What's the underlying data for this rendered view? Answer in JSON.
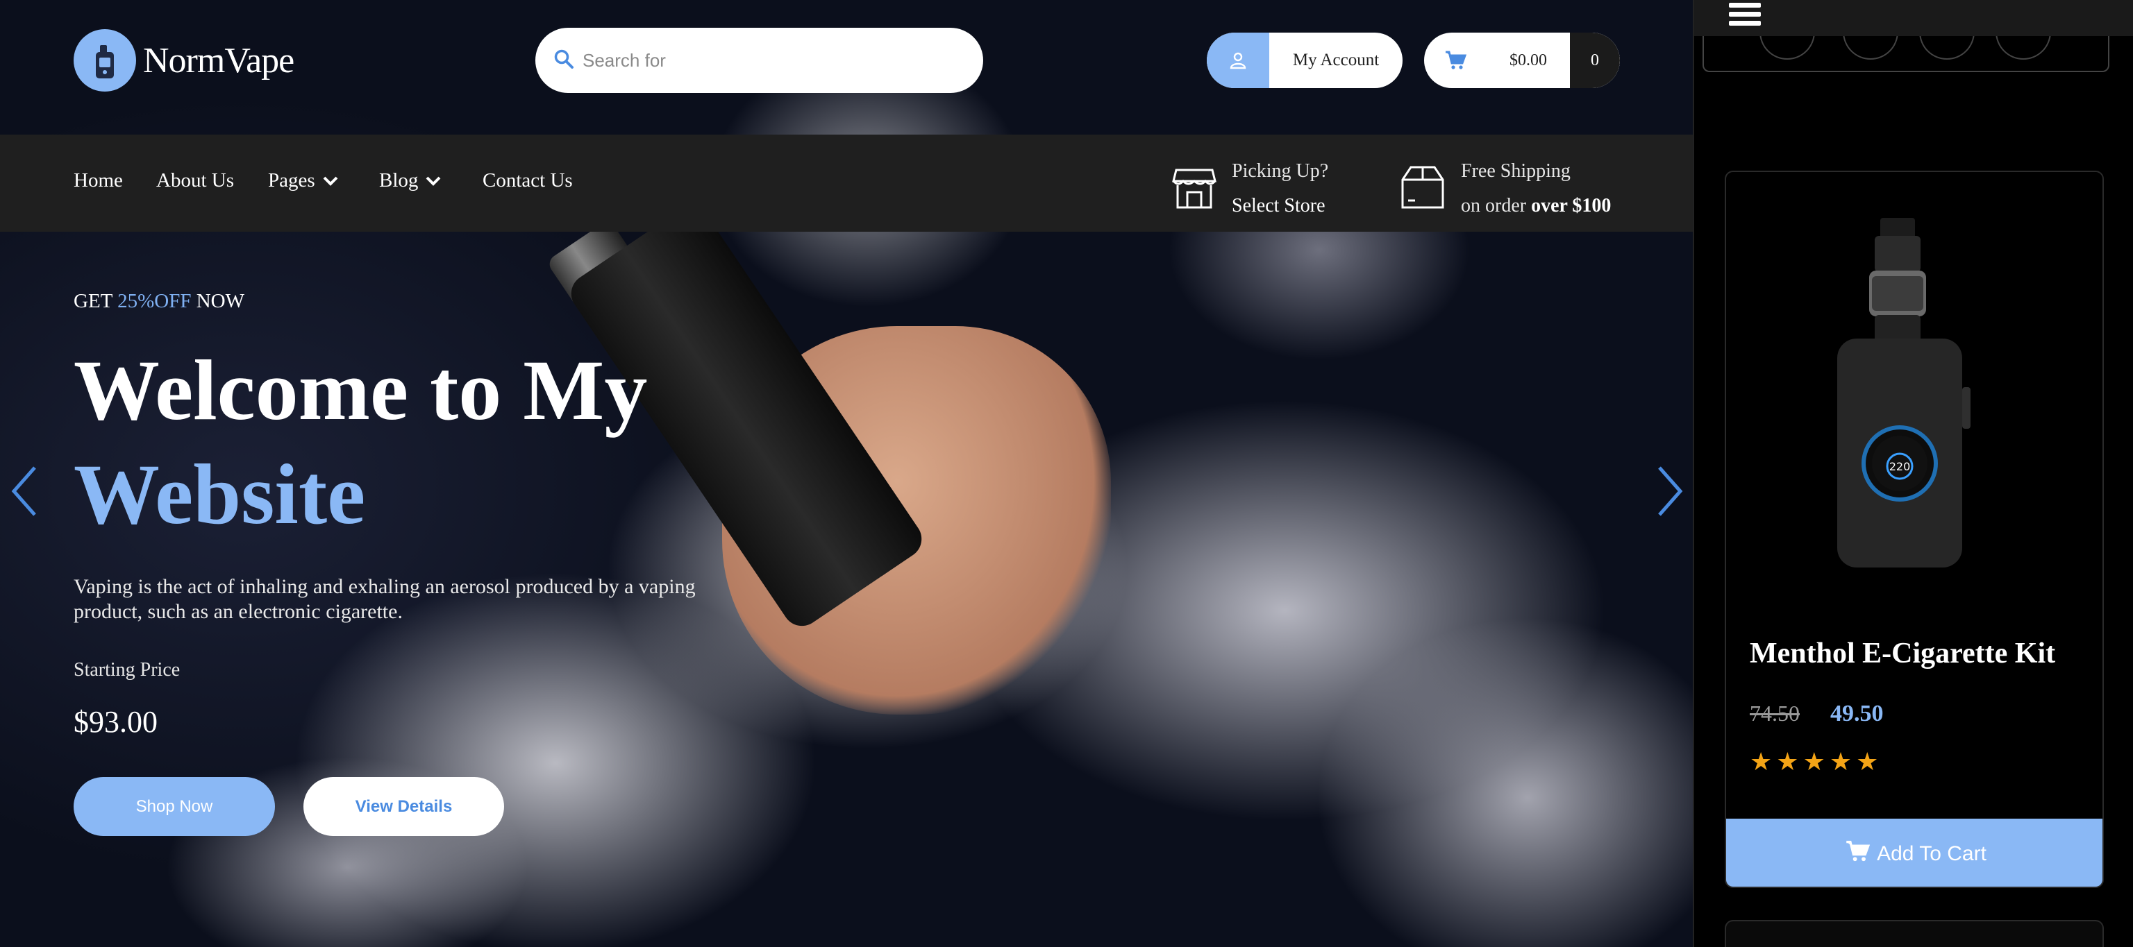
{
  "brand": {
    "name": "NormVape"
  },
  "search": {
    "placeholder": "Search for"
  },
  "account": {
    "label": "My Account"
  },
  "cart": {
    "amount": "$0.00",
    "count": "0"
  },
  "nav": {
    "items": [
      {
        "label": "Home",
        "dropdown": false
      },
      {
        "label": "About Us",
        "dropdown": false
      },
      {
        "label": "Pages",
        "dropdown": true
      },
      {
        "label": "Blog",
        "dropdown": true
      },
      {
        "label": "Contact Us",
        "dropdown": false
      }
    ],
    "pickup": {
      "line1": "Picking Up?",
      "line2": "Select Store"
    },
    "shipping": {
      "line1": "Free Shipping",
      "line2_prefix": "on order ",
      "line2_bold": "over $100"
    }
  },
  "hero": {
    "promo_prefix": "GET ",
    "promo_highlight": "25%OFF",
    "promo_suffix": " NOW",
    "title_line1": "Welcome to My",
    "title_line2": "Website",
    "description": "Vaping is the act of inhaling and exhaling an aerosol produced by a vaping product, such as an electronic cigarette.",
    "price_label": "Starting Price",
    "price": "$93.00",
    "shop_button": "Shop Now",
    "details_button": "View Details"
  },
  "product": {
    "name": "Menthol E-Cigarette Kit",
    "old_price": "74.50",
    "new_price": "49.50",
    "rating": 5,
    "rating_max": 5,
    "screen_value": "220",
    "add_to_cart": "Add To Cart"
  },
  "colors": {
    "accent": "#8ab8f5",
    "nav_bg": "#1f1f1f",
    "star": "#f4a416",
    "cart_count_bg": "#1b1b1b"
  }
}
